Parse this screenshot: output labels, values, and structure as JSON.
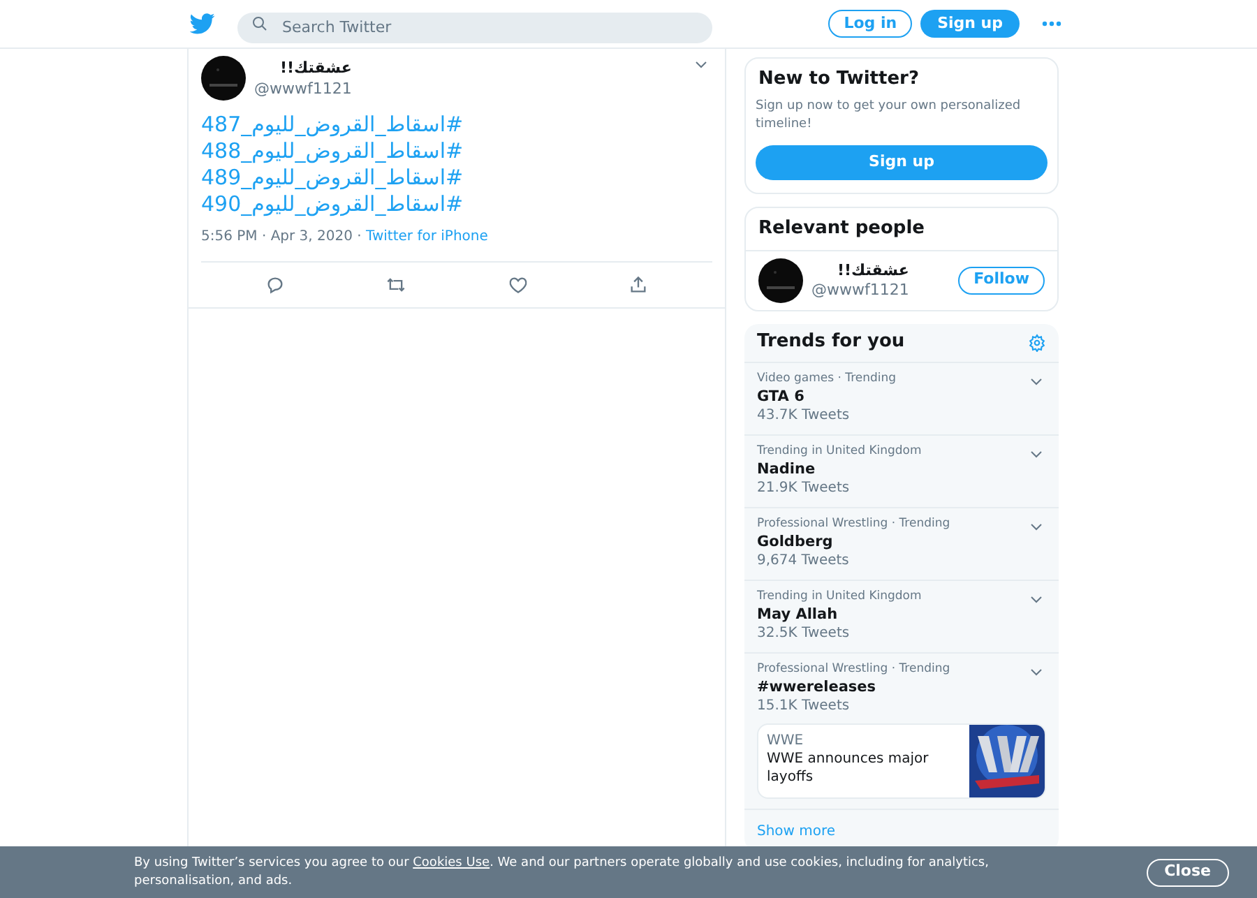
{
  "header": {
    "search": {
      "placeholder": "Search Twitter"
    },
    "buttons": [
      {
        "label": "Log in",
        "kind": "outline"
      },
      {
        "label": "Sign up",
        "kind": "filled"
      }
    ]
  },
  "tweet": {
    "name": "عشقتك!!",
    "handle": "@wwwf1121",
    "lines": [
      "#اسقاط_القروض_لليوم_487",
      "#اسقاط_القروض_لليوم_488",
      "#اسقاط_القروض_لليوم_489",
      "#اسقاط_القروض_لليوم_490"
    ],
    "time": "5:56 PM · Apr 3, 2020 · ",
    "source": "Twitter for iPhone"
  },
  "new_to_twitter": {
    "title": "New to Twitter?",
    "text": "Sign up now to get your own personalized timeline!",
    "button": "Sign up"
  },
  "relevant_people": {
    "title": "Relevant people",
    "people": [
      {
        "name": "عشقتك!!",
        "handle": "@wwwf1121",
        "button": "Follow"
      }
    ]
  },
  "trends": {
    "title": "Trends for you",
    "items": [
      {
        "context": "Video games · Trending",
        "name": "GTA 6",
        "count": "43.7K Tweets"
      },
      {
        "context": "Trending in United Kingdom",
        "name": "Nadine",
        "count": "21.9K Tweets"
      },
      {
        "context": "Professional Wrestling · Trending",
        "name": "Goldberg",
        "count": "9,674 Tweets"
      },
      {
        "context": "Trending in United Kingdom",
        "name": "May Allah",
        "count": "32.5K Tweets"
      },
      {
        "context": "Professional Wrestling · Trending",
        "name": "#wwereleases",
        "count": "15.1K Tweets",
        "card": {
          "source": "WWE",
          "headline": "WWE announces major layoffs",
          "kind": "picture"
        }
      }
    ],
    "show_more": "Show more"
  },
  "cookie_bar": {
    "before": "By using Twitter’s services you agree to our ",
    "link": "Cookies Use",
    "after": ". We and our partners operate globally and use cookies, including for analytics, personalisation, and ads.",
    "button": "Close"
  }
}
